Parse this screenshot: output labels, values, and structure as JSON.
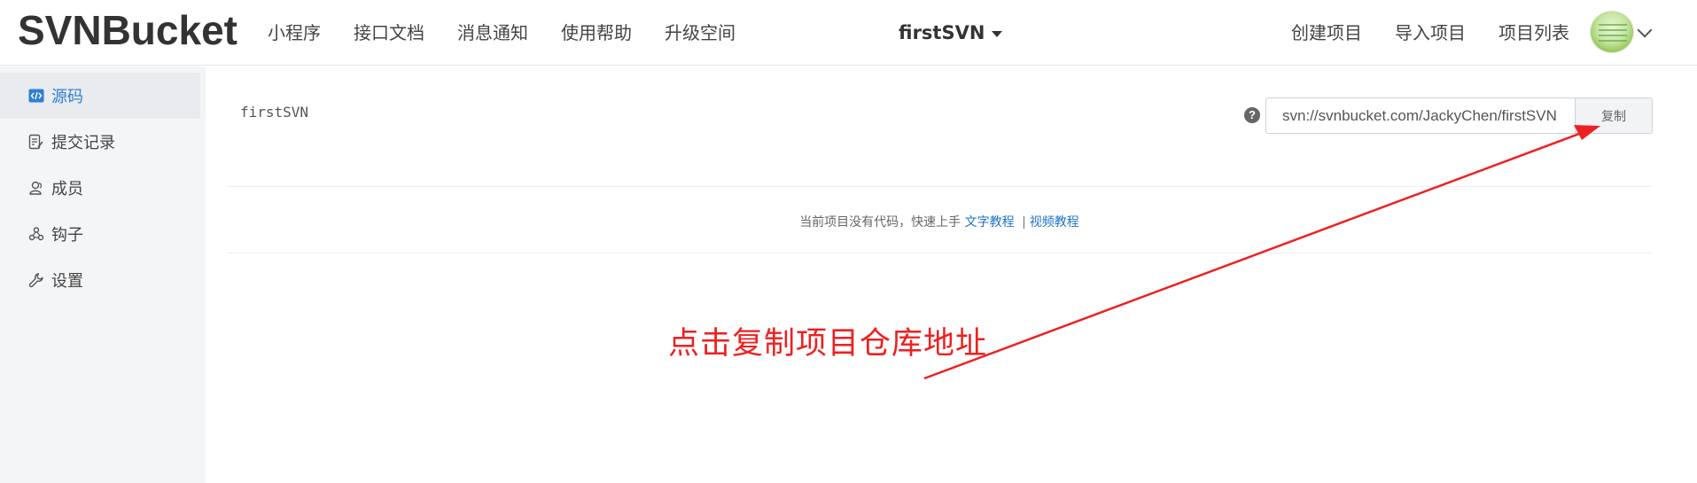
{
  "header": {
    "logo": "SVNBucket",
    "nav": [
      "小程序",
      "接口文档",
      "消息通知",
      "使用帮助",
      "升级空间"
    ],
    "project": "firstSVN",
    "right_nav": [
      "创建项目",
      "导入项目",
      "项目列表"
    ]
  },
  "sidebar": {
    "items": [
      {
        "label": "源码",
        "icon": "code-icon",
        "active": true
      },
      {
        "label": "提交记录",
        "icon": "commit-log-icon"
      },
      {
        "label": "成员",
        "icon": "members-icon"
      },
      {
        "label": "钩子",
        "icon": "webhook-icon"
      },
      {
        "label": "设置",
        "icon": "wrench-icon"
      }
    ]
  },
  "main": {
    "repo_name": "firstSVN",
    "repo_url": "svn://svnbucket.com/JackyChen/firstSVN",
    "copy_label": "复制",
    "empty_text": "当前项目没有代码，快速上手",
    "text_tutorial": "文字教程",
    "separator": "|",
    "video_tutorial": "视频教程"
  },
  "annotation": {
    "text": "点击复制项目仓库地址",
    "color": "#ee2020"
  },
  "colors": {
    "accent": "#2f7fd1",
    "link": "#1e73c6",
    "sidebar_bg": "#f4f5f7"
  }
}
